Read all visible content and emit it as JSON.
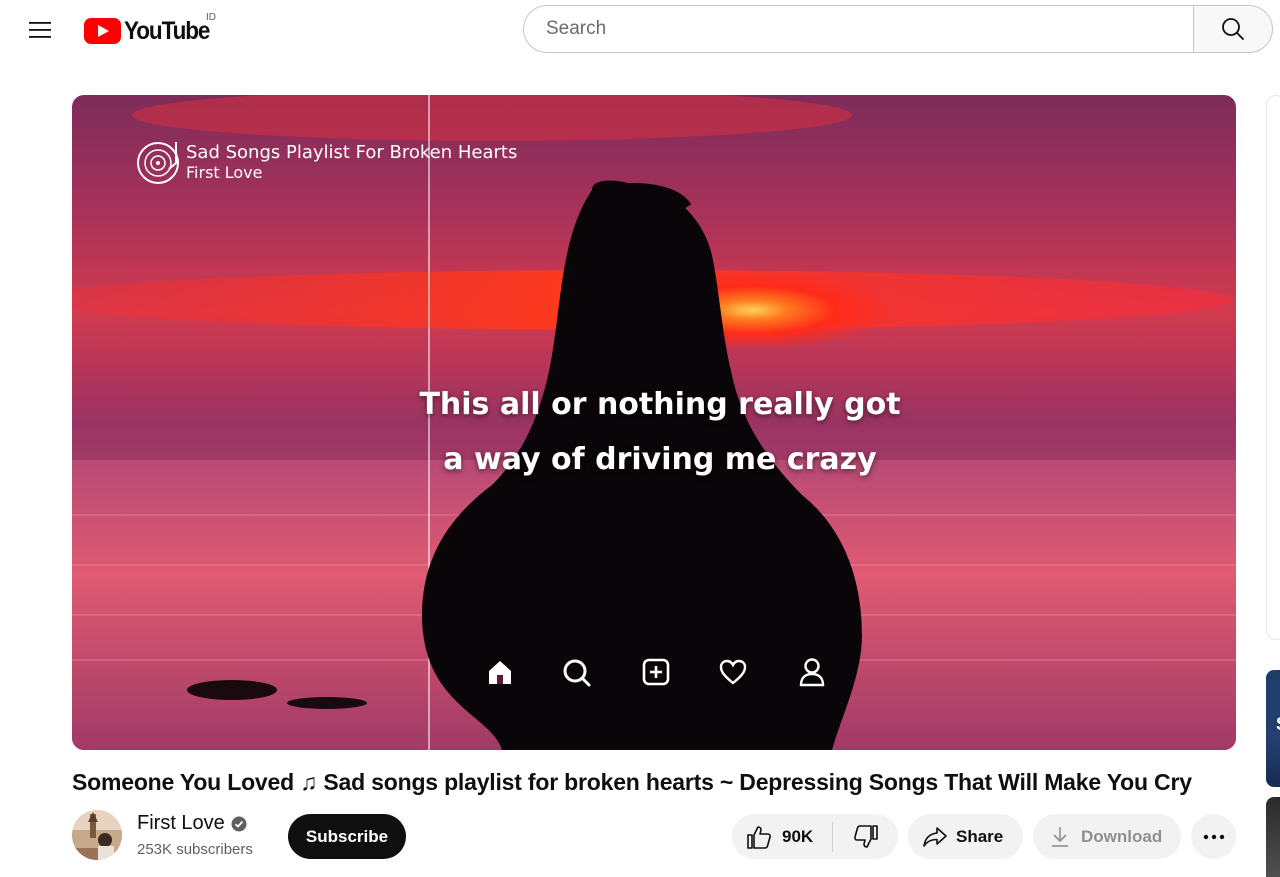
{
  "header": {
    "logo_text": "YouTube",
    "country_code": "ID",
    "search_placeholder": "Search"
  },
  "player": {
    "overlay_title": "Sad Songs Playlist For Broken Hearts",
    "overlay_subtitle": "First Love",
    "lyric_line1": "This all or nothing really got",
    "lyric_line2": "a way of driving me crazy",
    "nav_icons": [
      "home-icon",
      "search-icon",
      "add-icon",
      "heart-icon",
      "profile-icon"
    ]
  },
  "video": {
    "title": "Someone You Loved ♫ Sad songs playlist for broken hearts ~ Depressing Songs That Will Make You Cry"
  },
  "channel": {
    "name": "First Love",
    "verified": true,
    "subscribers": "253K subscribers",
    "subscribe_label": "Subscribe"
  },
  "actions": {
    "like_count": "90K",
    "share_label": "Share",
    "download_label": "Download"
  },
  "sidebar": {
    "peek_text": "S"
  },
  "colors": {
    "brand_red": "#ff0000",
    "subscribe_bg": "#0f0f0f",
    "pill_bg": "#f2f2f2",
    "sky_magenta": "#8e2f5c",
    "horizon_red": "#ff2a1a"
  }
}
